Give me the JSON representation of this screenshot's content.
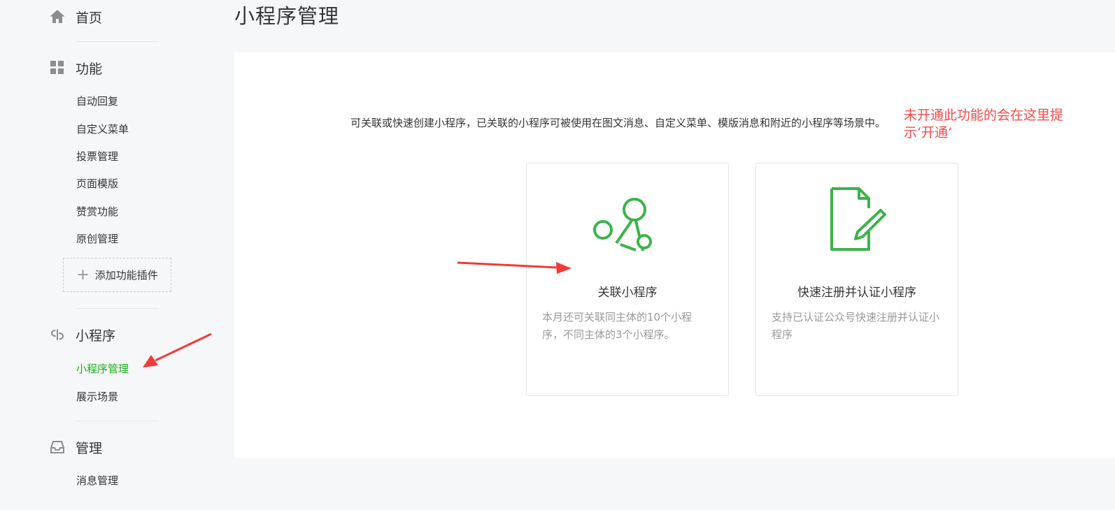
{
  "sidebar": {
    "home": {
      "label": "首页",
      "icon": "home-icon"
    },
    "features": {
      "label": "功能",
      "icon": "grid-icon",
      "items": [
        "自动回复",
        "自定义菜单",
        "投票管理",
        "页面模版",
        "赞赏功能",
        "原创管理"
      ],
      "add_plugin": "添加功能插件"
    },
    "miniprogram": {
      "label": "小程序",
      "icon": "link-icon",
      "items": [
        "小程序管理",
        "展示场景"
      ],
      "active_item": "小程序管理"
    },
    "manage": {
      "label": "管理",
      "icon": "inbox-icon",
      "items": [
        "消息管理"
      ]
    }
  },
  "main": {
    "title": "小程序管理",
    "description": "可关联或快速创建小程序，已关联的小程序可被使用在图文消息、自定义菜单、模版消息和附近的小程序等场景中。",
    "annotation": "未开通此功能的会在这里提示‘开通’",
    "cards": [
      {
        "title": "关联小程序",
        "desc": "本月还可关联同主体的10个小程序，不同主体的3个小程序。",
        "icon": "network-nodes-icon"
      },
      {
        "title": "快速注册并认证小程序",
        "desc": "支持已认证公众号快速注册并认证小程序",
        "icon": "document-pen-icon"
      }
    ]
  },
  "colors": {
    "accent_green": "#1aad19",
    "icon_green": "#3cb34a",
    "annotation_red": "#f24b4b",
    "text_primary": "#353535",
    "text_secondary": "#9a9a9a",
    "background": "#f6f7f9"
  }
}
